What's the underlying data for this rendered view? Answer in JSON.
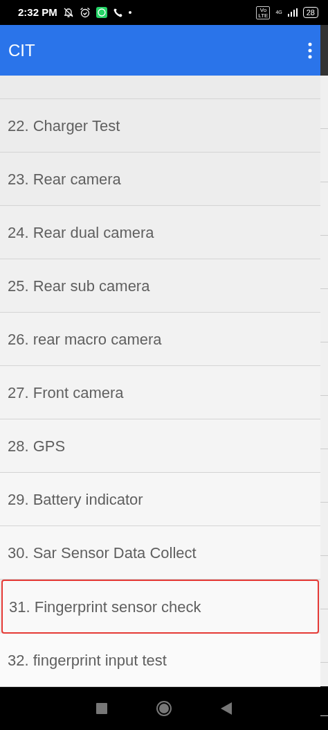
{
  "status_bar": {
    "time": "2:32 PM",
    "volte": "Vo LTE",
    "network": "4G",
    "battery": "28"
  },
  "app_bar": {
    "title": "CIT"
  },
  "items": [
    {
      "label": "22. Charger Test",
      "selected": false
    },
    {
      "label": "23. Rear camera",
      "selected": false
    },
    {
      "label": "24. Rear dual camera",
      "selected": false
    },
    {
      "label": "25. Rear sub camera",
      "selected": false
    },
    {
      "label": "26. rear macro camera",
      "selected": false
    },
    {
      "label": "27. Front camera",
      "selected": false
    },
    {
      "label": "28. GPS",
      "selected": false
    },
    {
      "label": "29. Battery indicator",
      "selected": false
    },
    {
      "label": "30. Sar Sensor Data Collect",
      "selected": false
    },
    {
      "label": "31. Fingerprint sensor check",
      "selected": true
    },
    {
      "label": "32. fingerprint input test",
      "selected": false
    }
  ]
}
